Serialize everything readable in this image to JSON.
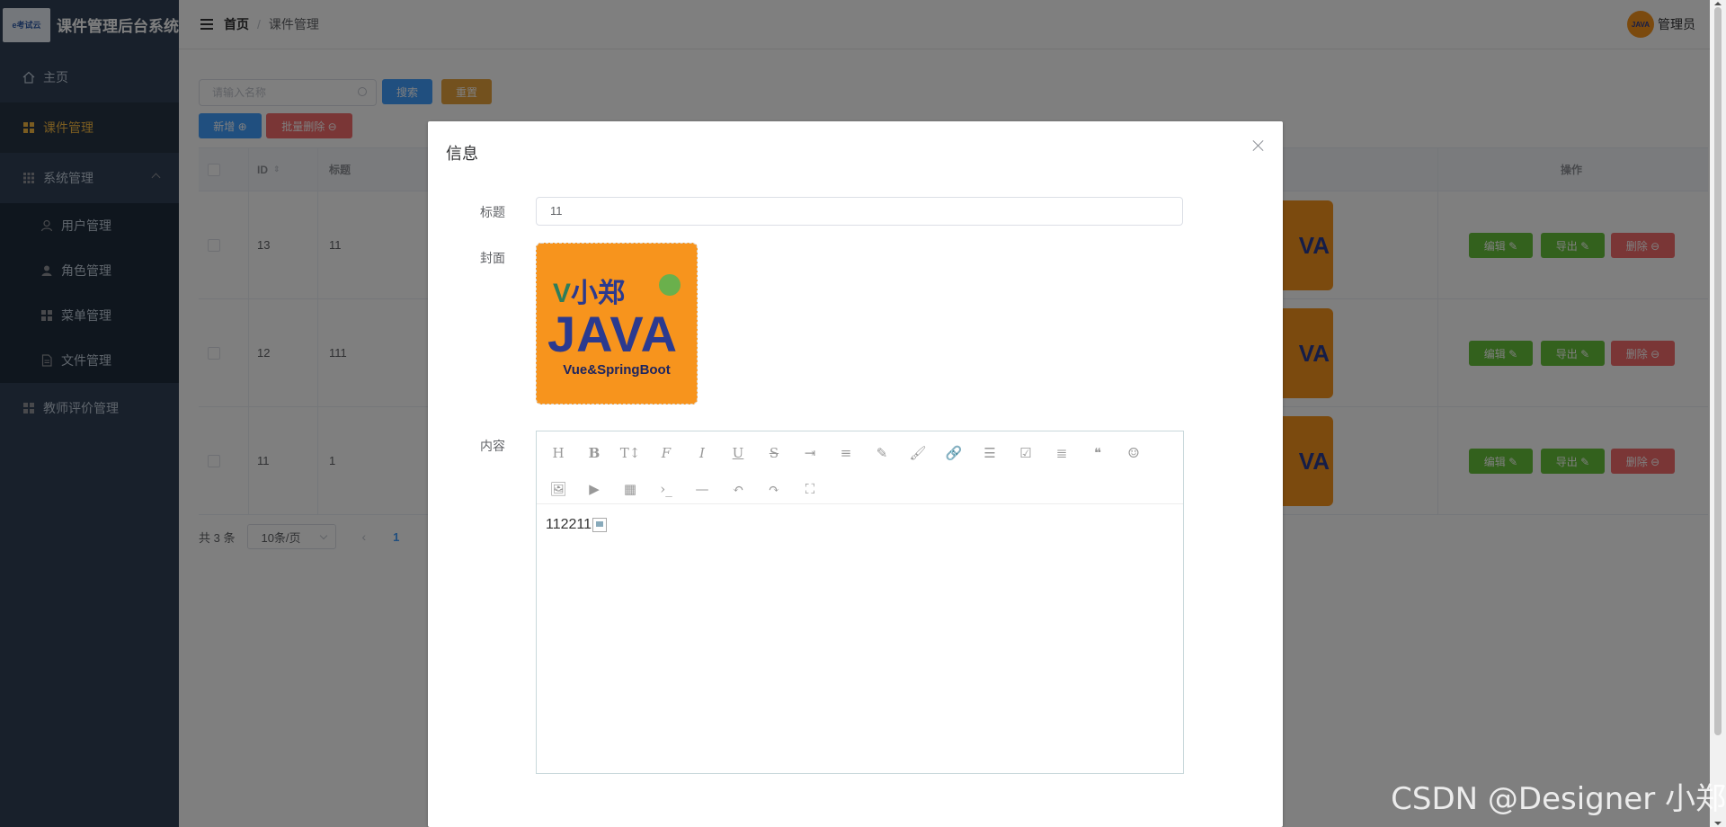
{
  "app": {
    "logo_text": "e考试云",
    "title": "课件管理后台系统"
  },
  "sidebar": {
    "items": [
      {
        "label": "主页",
        "icon": "home-icon"
      },
      {
        "label": "课件管理",
        "icon": "grid-icon",
        "active": true
      },
      {
        "label": "系统管理",
        "icon": "apps-icon",
        "expanded": true
      },
      {
        "label": "教师评价管理",
        "icon": "grid-icon"
      }
    ],
    "sub_items": [
      {
        "label": "用户管理",
        "icon": "user-icon"
      },
      {
        "label": "角色管理",
        "icon": "user-solid-icon"
      },
      {
        "label": "菜单管理",
        "icon": "menu-icon"
      },
      {
        "label": "文件管理",
        "icon": "document-icon"
      }
    ]
  },
  "header": {
    "breadcrumb": [
      "首页",
      "课件管理"
    ],
    "user": "管理员",
    "avatar_text": "JAVA"
  },
  "toolbar": {
    "search_placeholder": "请输入名称",
    "search_label": "搜索",
    "reset_label": "重置",
    "add_label": "新增 ⊕",
    "batch_delete_label": "批量删除 ⊖"
  },
  "table": {
    "columns": [
      "ID",
      "标题",
      "操作"
    ],
    "rows": [
      {
        "id": "13",
        "title": "11"
      },
      {
        "id": "12",
        "title": "111"
      },
      {
        "id": "11",
        "title": "1"
      }
    ],
    "cover_text": "VA\nboot",
    "actions": {
      "edit": "编辑 ✎",
      "export": "导出 ✎",
      "delete": "删除 ⊖"
    }
  },
  "pager": {
    "total": "共 3 条",
    "page_size": "10条/页",
    "current": "1"
  },
  "dialog": {
    "title": "信息",
    "title_label": "标题",
    "title_value": "11",
    "cover_label": "封面",
    "cover_brand": "小郑",
    "cover_java": "JAVA",
    "cover_sub": "Vue&SpringBoot",
    "content_label": "内容",
    "content_text": "112211",
    "toolbar_icons": [
      "H",
      "B",
      "T↕",
      "F",
      "I",
      "U",
      "S",
      "⇥",
      "≡",
      "✎",
      "🖌",
      "🔗",
      "☰",
      "☑",
      "≣",
      "❝",
      "☺",
      "🖼",
      "▶",
      "▦",
      "›_",
      "—",
      "↶",
      "↷",
      "⛶"
    ]
  },
  "watermark": "CSDN @Designer 小郑",
  "colors": {
    "primary": "#409eff",
    "success": "#67c23a",
    "warning": "#e6a23c",
    "danger": "#f56c6c",
    "sidebar_bg": "#304156",
    "active": "#f4b942"
  }
}
